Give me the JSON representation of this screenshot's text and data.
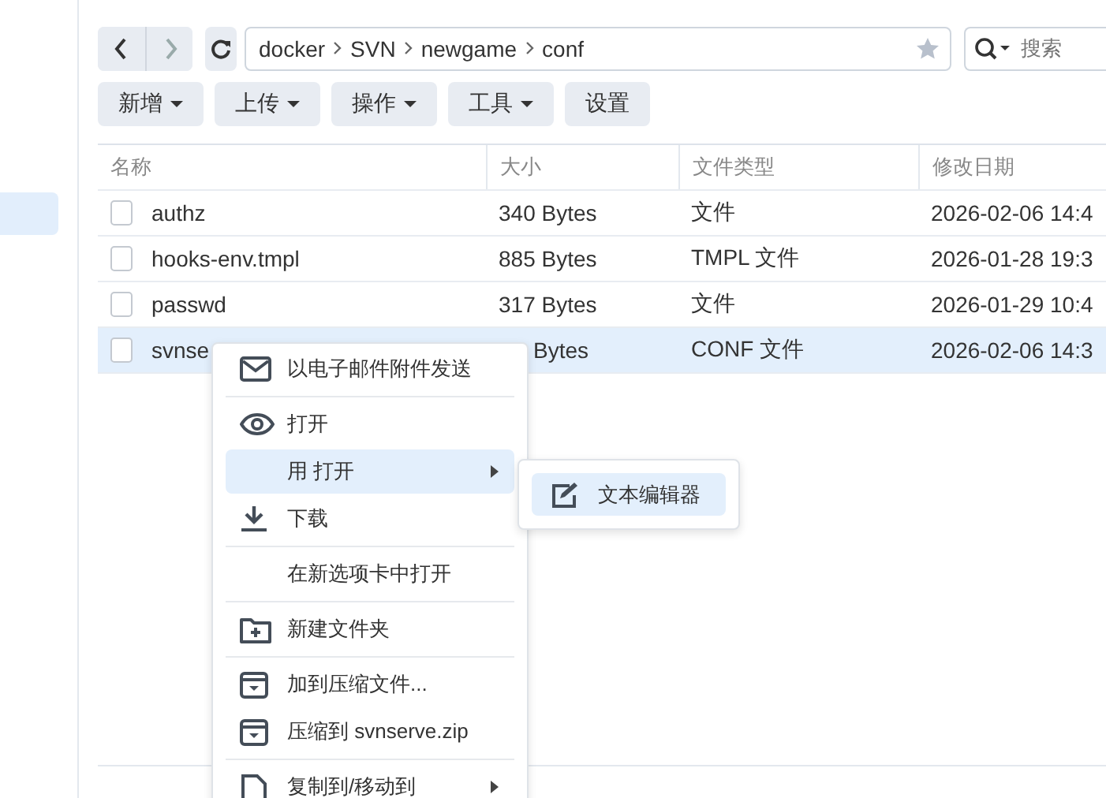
{
  "sidebar": {
    "items": [
      {
        "selected": true
      }
    ]
  },
  "toolbar": {
    "path": [
      "docker",
      "SVN",
      "newgame",
      "conf"
    ],
    "search": {
      "placeholder": "搜索"
    },
    "buttons": [
      {
        "label": "新增",
        "dropdown": true
      },
      {
        "label": "上传",
        "dropdown": true
      },
      {
        "label": "操作",
        "dropdown": true
      },
      {
        "label": "工具",
        "dropdown": true
      },
      {
        "label": "设置",
        "dropdown": false
      }
    ]
  },
  "table": {
    "columns": [
      "名称",
      "大小",
      "文件类型",
      "修改日期"
    ],
    "rows": [
      {
        "name": "authz",
        "size": "340 Bytes",
        "type": "文件",
        "modified": "2026-02-06 14:4",
        "selected": false
      },
      {
        "name": "hooks-env.tmpl",
        "size": "885 Bytes",
        "type": "TMPL 文件",
        "modified": "2026-01-28 19:3",
        "selected": false
      },
      {
        "name": "passwd",
        "size": "317 Bytes",
        "type": "文件",
        "modified": "2026-01-29 10:4",
        "selected": false
      },
      {
        "name": "svnse",
        "size": "Bytes",
        "type": "CONF 文件",
        "modified": "2026-02-06 14:3",
        "selected": true
      }
    ]
  },
  "context_menu": {
    "items": [
      {
        "kind": "mail",
        "label": "以电子邮件附件发送",
        "selected": false,
        "submenu": false
      },
      {
        "kind": "separator"
      },
      {
        "kind": "view",
        "label": "打开",
        "selected": false,
        "submenu": false
      },
      {
        "kind": "plain",
        "label": "用 打开",
        "selected": true,
        "submenu": true
      },
      {
        "kind": "download",
        "label": "下载",
        "selected": false,
        "submenu": false
      },
      {
        "kind": "separator"
      },
      {
        "kind": "plain",
        "label": "在新选项卡中打开",
        "selected": false,
        "submenu": false
      },
      {
        "kind": "separator"
      },
      {
        "kind": "folder",
        "label": "新建文件夹",
        "selected": false,
        "submenu": false
      },
      {
        "kind": "separator"
      },
      {
        "kind": "archive",
        "label": "加到压缩文件...",
        "selected": false,
        "submenu": false
      },
      {
        "kind": "archive",
        "label": "压缩到 svnserve.zip",
        "selected": false,
        "submenu": false
      },
      {
        "kind": "separator"
      },
      {
        "kind": "document",
        "label": "复制到/移动到",
        "selected": false,
        "submenu": true
      }
    ]
  },
  "submenu": {
    "items": [
      {
        "kind": "edit",
        "label": "文本编辑器",
        "selected": true
      }
    ]
  }
}
